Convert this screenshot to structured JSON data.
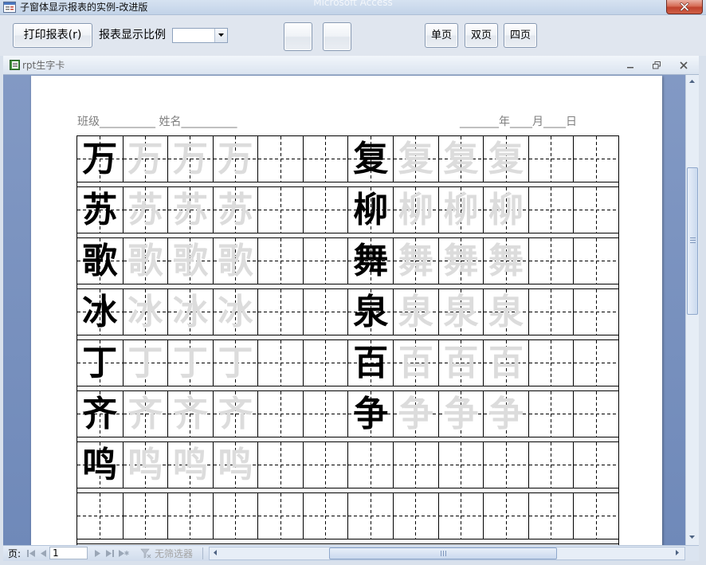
{
  "window": {
    "title": "子窗体显示报表的实例-改进版",
    "app_name": "Microsoft Access",
    "icon": "form-icon",
    "close_icon": "close-icon"
  },
  "toolbar": {
    "print_button": "打印报表(r)",
    "zoom_label": "报表显示比例",
    "zoom_dropdown_icon": "chevron-down-icon",
    "page_buttons": [
      "单页",
      "双页",
      "四页"
    ]
  },
  "report_window": {
    "title": "rpt生字卡",
    "icon": "report-icon",
    "controls": [
      "minimize-icon",
      "restore-icon",
      "close-icon"
    ]
  },
  "report": {
    "header_left": "班级__________ 姓名__________",
    "header_right": "_______年____月____日",
    "rows": [
      [
        "万",
        "复"
      ],
      [
        "苏",
        "柳"
      ],
      [
        "歌",
        "舞"
      ],
      [
        "冰",
        "泉"
      ],
      [
        "丁",
        "百"
      ],
      [
        "齐",
        "争"
      ],
      [
        "鸣",
        ""
      ],
      [
        "",
        ""
      ]
    ]
  },
  "navigation": {
    "page_label": "页:",
    "page_value": "1",
    "filter_label": "无筛选器",
    "icons": [
      "first-record-icon",
      "previous-record-icon",
      "next-record-icon",
      "last-record-icon",
      "new-record-icon",
      "filter-icon"
    ]
  },
  "colors": {
    "trace_character": "#dcdcdc",
    "preview_background": "#7a93c1",
    "close_button": "#c7503b"
  }
}
